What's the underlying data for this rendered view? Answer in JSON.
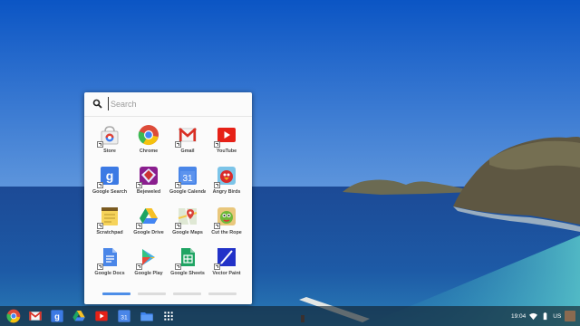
{
  "launcher": {
    "search": {
      "placeholder": "Search",
      "value": ""
    },
    "apps": [
      {
        "label": "Store",
        "icon": "web-store-icon"
      },
      {
        "label": "Chrome",
        "icon": "chrome-icon"
      },
      {
        "label": "Gmail",
        "icon": "gmail-icon"
      },
      {
        "label": "YouTube",
        "icon": "youtube-icon"
      },
      {
        "label": "Google Search",
        "icon": "google-search-icon"
      },
      {
        "label": "Bejeweled",
        "icon": "bejeweled-icon"
      },
      {
        "label": "Google Calendar",
        "icon": "google-calendar-icon"
      },
      {
        "label": "Angry Birds",
        "icon": "angry-birds-icon"
      },
      {
        "label": "Scratchpad",
        "icon": "scratchpad-icon"
      },
      {
        "label": "Google Drive",
        "icon": "google-drive-icon"
      },
      {
        "label": "Google Maps",
        "icon": "google-maps-icon"
      },
      {
        "label": "Cut the Rope",
        "icon": "cut-the-rope-icon"
      },
      {
        "label": "Google Docs",
        "icon": "google-docs-icon"
      },
      {
        "label": "Google Play",
        "icon": "google-play-icon"
      },
      {
        "label": "Google Sheets",
        "icon": "google-sheets-icon"
      },
      {
        "label": "Vector Paint",
        "icon": "vector-paint-icon"
      }
    ],
    "pages": {
      "count": 4,
      "active": 1
    }
  },
  "shelf": {
    "items": [
      {
        "name": "chrome",
        "icon": "chrome-icon"
      },
      {
        "name": "gmail",
        "icon": "gmail-icon"
      },
      {
        "name": "google-search",
        "icon": "google-search-icon"
      },
      {
        "name": "google-drive",
        "icon": "google-drive-icon"
      },
      {
        "name": "youtube",
        "icon": "youtube-icon"
      },
      {
        "name": "google-calendar",
        "icon": "google-calendar-icon"
      },
      {
        "name": "files",
        "icon": "folder-icon"
      },
      {
        "name": "app-launcher",
        "icon": "apps-grid-icon"
      }
    ]
  },
  "status": {
    "time": "19:04",
    "language": "US"
  },
  "colors": {
    "sky": "#1e63c8",
    "sea": "#1b4f9a",
    "accent": "#4d8ee8"
  }
}
